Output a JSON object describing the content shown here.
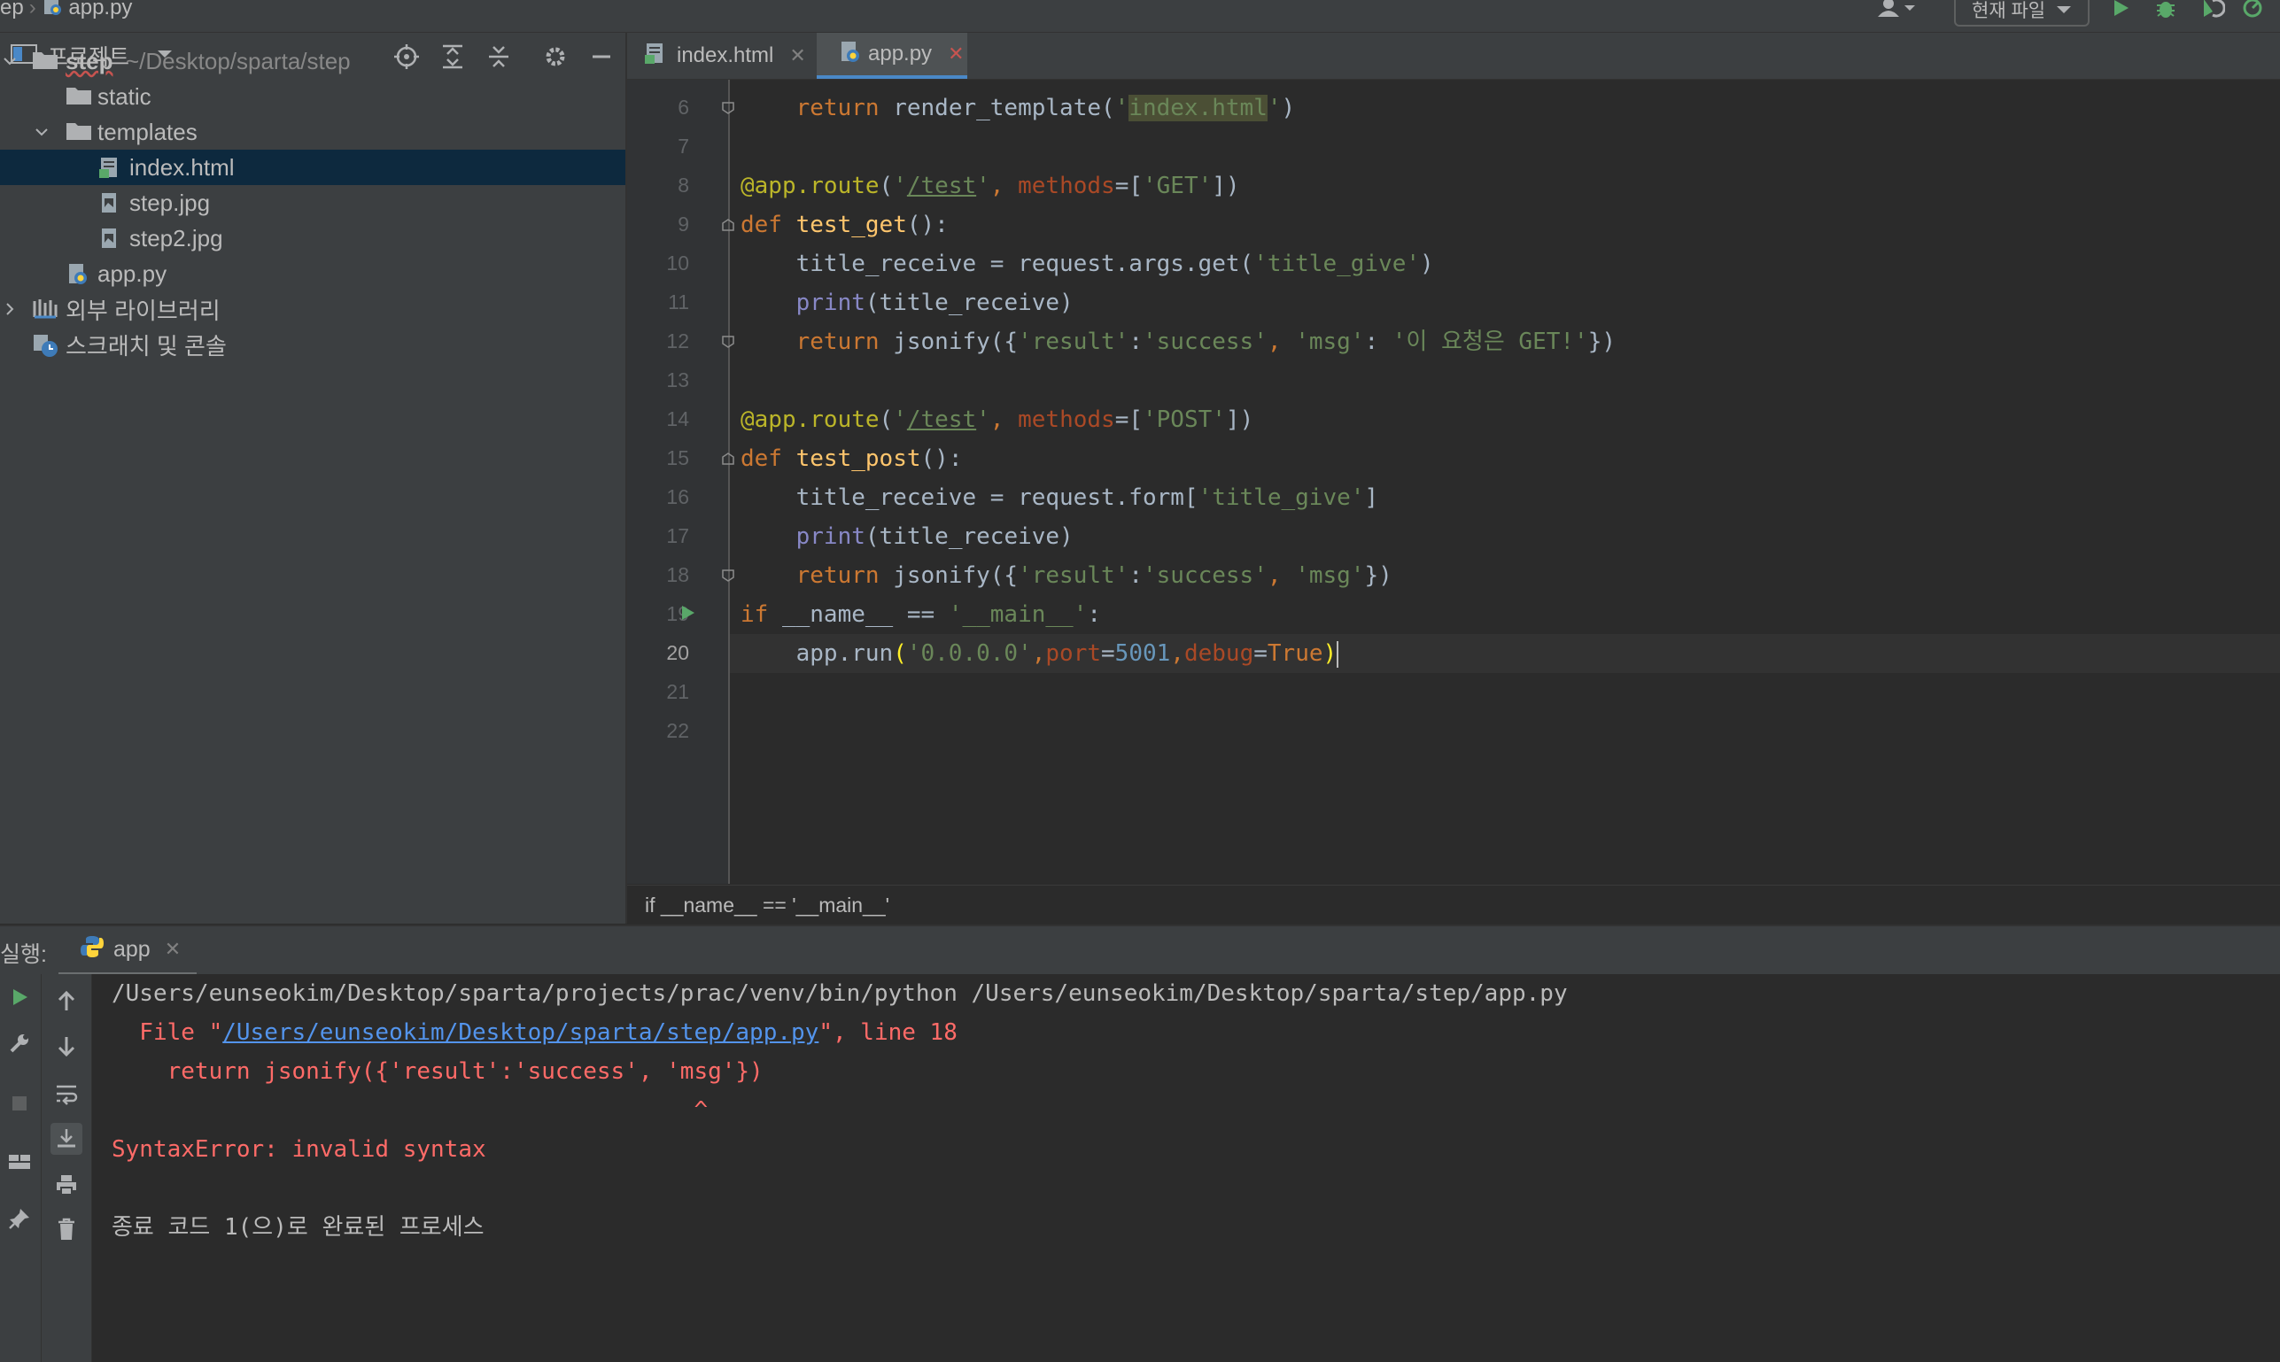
{
  "topbar": {
    "breadcrumb_project": "ep",
    "breadcrumb_file": "app.py",
    "run_config": "현재 파일",
    "icons": [
      "user-icon",
      "run-icon",
      "debug-icon",
      "coverage-icon",
      "profile-icon"
    ]
  },
  "project_panel": {
    "title": "프로젝트",
    "tree": {
      "root_name": "step",
      "root_path": "~/Desktop/sparta/step",
      "static": "static",
      "templates": "templates",
      "index_html": "index.html",
      "step_jpg": "step.jpg",
      "step2_jpg": "step2.jpg",
      "app_py": "app.py",
      "external_libraries": "외부 라이브러리",
      "scratches": "스크래치 및 콘솔"
    }
  },
  "editor": {
    "tabs": [
      {
        "label": "index.html",
        "active": false
      },
      {
        "label": "app.py",
        "active": true
      }
    ],
    "line_numbers": [
      "6",
      "7",
      "8",
      "9",
      "10",
      "11",
      "12",
      "13",
      "14",
      "15",
      "16",
      "17",
      "18",
      "19",
      "20",
      "21",
      "22"
    ],
    "current_line": "20",
    "code": {
      "l6_indent": "    ",
      "l6_kw": "return",
      "l6_a": " render_template(",
      "l6_q1": "'",
      "l6_hl": "index.html",
      "l6_q2": "'",
      "l6_b": ")",
      "l8_dec": "@app.route",
      "l8_p": "(",
      "l8_q1": "'",
      "l8_url": "/test",
      "l8_q2": "'",
      "l8_c": ", ",
      "l8_kwarg": "methods",
      "l8_eq": "=[",
      "l8_s": "'GET'",
      "l8_end": "])",
      "l9_kw": "def",
      "l9_sp": " ",
      "l9_fn": "test_get",
      "l9_end": "():",
      "l10_a": "    title_receive = request.args.get(",
      "l10_s": "'title_give'",
      "l10_b": ")",
      "l11_indent": "    ",
      "l11_bi": "print",
      "l11_b": "(title_receive)",
      "l12_indent": "    ",
      "l12_kw": "return",
      "l12_a": " jsonify({",
      "l12_s1": "'result'",
      "l12_c1": ":",
      "l12_s2": "'success'",
      "l12_c2": ", ",
      "l12_s3": "'msg'",
      "l12_c3": ": ",
      "l12_s4": "'이 요청은 GET!'",
      "l12_b": "})",
      "l14_dec": "@app.route",
      "l14_p": "(",
      "l14_q1": "'",
      "l14_url": "/test",
      "l14_q2": "'",
      "l14_c": ", ",
      "l14_kwarg": "methods",
      "l14_eq": "=[",
      "l14_s": "'POST'",
      "l14_end": "])",
      "l15_kw": "def",
      "l15_sp": " ",
      "l15_fn": "test_post",
      "l15_end": "():",
      "l16_a": "    title_receive = request.form[",
      "l16_s": "'title_give'",
      "l16_b": "]",
      "l17_indent": "    ",
      "l17_bi": "print",
      "l17_b": "(title_receive)",
      "l18_indent": "    ",
      "l18_kw": "return",
      "l18_a": " jsonify({",
      "l18_s1": "'result'",
      "l18_c1": ":",
      "l18_s2": "'success'",
      "l18_c2": ", ",
      "l18_s3": "'msg'",
      "l18_b": "})",
      "l19_kw": "if",
      "l19_a": " __name__ == ",
      "l19_s": "'__main__'",
      "l19_b": ":",
      "l20_a": "    app.run",
      "l20_p1": "(",
      "l20_s": "'0.0.0.0'",
      "l20_c1": ",",
      "l20_k1": "port",
      "l20_eq1": "=",
      "l20_n": "5001",
      "l20_c2": ",",
      "l20_k2": "debug",
      "l20_eq2": "=",
      "l20_kw": "True",
      "l20_p2": ")"
    },
    "breadcrumb": "if __name__ == '__main__'"
  },
  "run_panel": {
    "label": "실행:",
    "tab": "app",
    "console": {
      "command": "/Users/eunseokim/Desktop/sparta/projects/prac/venv/bin/python /Users/eunseokim/Desktop/sparta/step/app.py",
      "file_prefix": "  File \"",
      "file_link": "/Users/eunseokim/Desktop/sparta/step/app.py",
      "file_suffix": "\", line 18",
      "code_line": "    return jsonify({'result':'success', 'msg'})",
      "caret": "                                          ^",
      "error": "SyntaxError: invalid syntax",
      "exit_message": "종료 코드 1(으)로 완료된 프로세스"
    }
  },
  "colors": {
    "keyword": "#cc7832",
    "function": "#ffc66d",
    "string": "#6a8759",
    "decorator": "#bbb529",
    "number": "#6897bb",
    "error": "#ff6b68",
    "link": "#5394ec",
    "selection": "#0d293e"
  }
}
